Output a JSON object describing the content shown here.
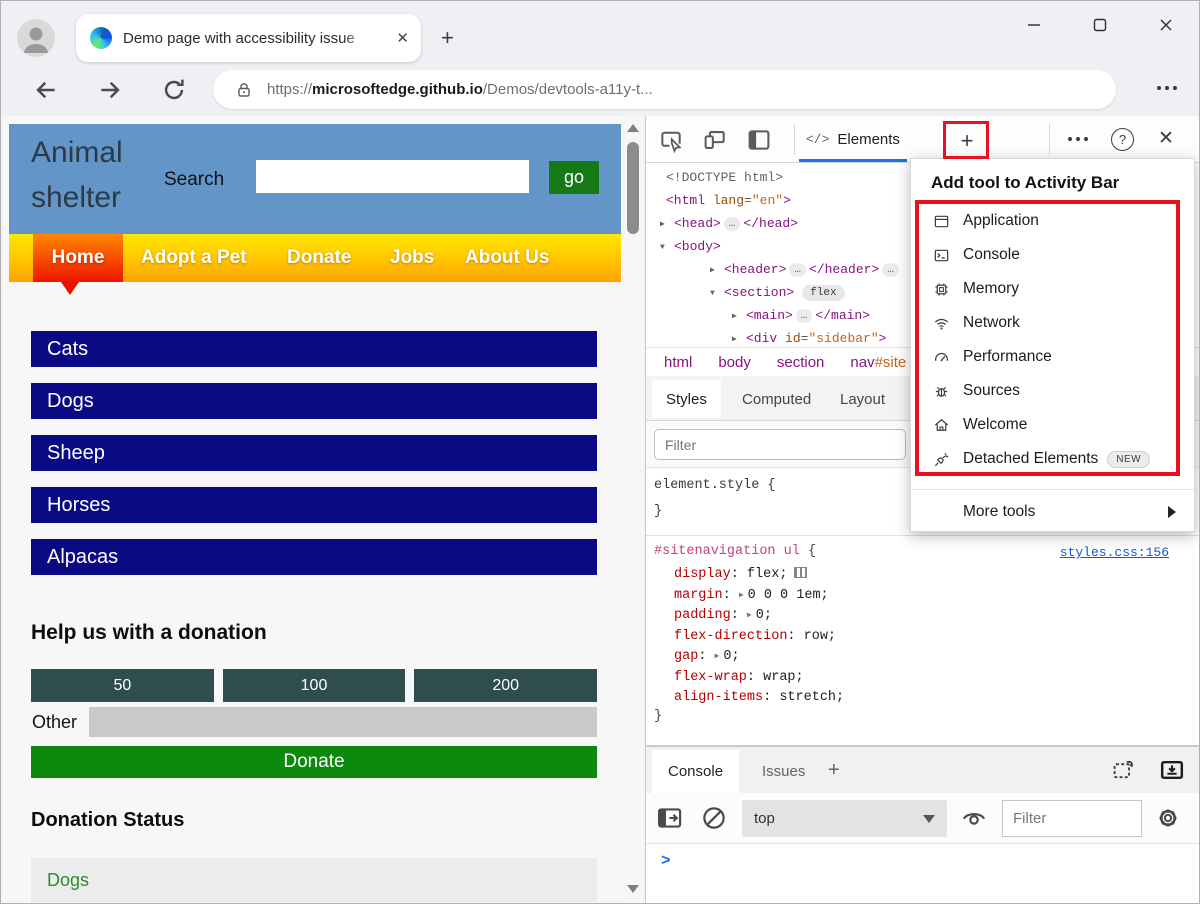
{
  "browser": {
    "tab_title": "Demo page with accessibility issue",
    "tab_close": "✕",
    "url": {
      "scheme": "https://",
      "domain": "microsoftedge.github.io",
      "path": "/Demos/devtools-a11y-t..."
    }
  },
  "page": {
    "site_title": "Animal shelter",
    "search_label": "Search",
    "go_button": "go",
    "nav_items": [
      "Home",
      "Adopt a Pet",
      "Donate",
      "Jobs",
      "About Us"
    ],
    "animals": [
      "Cats",
      "Dogs",
      "Sheep",
      "Horses",
      "Alpacas"
    ],
    "donation_heading": "Help us with a donation",
    "amounts": [
      "50",
      "100",
      "200"
    ],
    "other_label": "Other",
    "donate_button": "Donate",
    "status_heading": "Donation Status",
    "status_rows": [
      "Dogs"
    ]
  },
  "devtools": {
    "elements_tab_label": "Elements",
    "elements_tab_glyph": "</>",
    "dom_lines": [
      {
        "indent": 0,
        "parts": [
          [
            "doctype",
            "<!DOCTYPE html>"
          ]
        ]
      },
      {
        "indent": 0,
        "parts": [
          [
            "tag",
            "<html "
          ],
          [
            "attr",
            "lang"
          ],
          [
            "plain",
            "="
          ],
          [
            "val",
            "\"en\""
          ],
          [
            "tag",
            ">"
          ]
        ]
      },
      {
        "indent": 1,
        "arrow": "r",
        "parts": [
          [
            "tag",
            "<head>"
          ],
          [
            "dots",
            "…"
          ],
          [
            "tag",
            "</head>"
          ]
        ]
      },
      {
        "indent": 1,
        "arrow": "d",
        "parts": [
          [
            "tag",
            "<body>"
          ]
        ]
      },
      {
        "indent": 2,
        "arrow": "r",
        "parts": [
          [
            "tag",
            "<header>"
          ],
          [
            "dots",
            "…"
          ],
          [
            "tag",
            "</header>"
          ],
          [
            "dots",
            "…"
          ]
        ]
      },
      {
        "indent": 2,
        "arrow": "d",
        "parts": [
          [
            "tag",
            "<section>"
          ],
          [
            "flex",
            "flex"
          ]
        ]
      },
      {
        "indent": 3,
        "arrow": "r",
        "parts": [
          [
            "tag",
            "<main>"
          ],
          [
            "dots",
            "…"
          ],
          [
            "tag",
            "</main>"
          ]
        ]
      },
      {
        "indent": 3,
        "arrow": "r",
        "parts": [
          [
            "tag",
            "<div "
          ],
          [
            "attr",
            "id"
          ],
          [
            "plain",
            "="
          ],
          [
            "val",
            "\"sidebar\""
          ],
          [
            "tag",
            ">"
          ]
        ]
      }
    ],
    "breadcrumb": [
      "html",
      "body",
      "section"
    ],
    "breadcrumb_last": {
      "tag": "nav",
      "id": "#site"
    },
    "styles_tabs": [
      "Styles",
      "Computed",
      "Layout"
    ],
    "styles_filter_placeholder": "Filter",
    "element_style_open": "element.style {",
    "element_style_close": "}",
    "rule": {
      "selector": "#sitenavigation ul",
      "brace_open": "{",
      "brace_close": "}",
      "source_link": "styles.css:156",
      "properties": [
        {
          "name": "display",
          "value": "flex",
          "icon": "flex"
        },
        {
          "name": "margin",
          "value": "0 0 0 1em",
          "exp": true
        },
        {
          "name": "padding",
          "value": "0",
          "exp": true
        },
        {
          "name": "flex-direction",
          "value": "row"
        },
        {
          "name": "gap",
          "value": "0",
          "exp": true
        },
        {
          "name": "flex-wrap",
          "value": "wrap"
        },
        {
          "name": "align-items",
          "value": "stretch"
        }
      ]
    },
    "menu": {
      "title": "Add tool to Activity Bar",
      "items": [
        "Application",
        "Console",
        "Memory",
        "Network",
        "Performance",
        "Sources",
        "Welcome",
        "Detached Elements"
      ],
      "new_badge": "NEW",
      "more_tools": "More tools"
    },
    "drawer": {
      "tabs": [
        "Console",
        "Issues"
      ],
      "context_selector": "top",
      "filter_placeholder": "Filter"
    }
  },
  "colors": {
    "annotation_red": "#e81123",
    "accent_blue": "#1a73e8",
    "page_header_blue": "#6495c8",
    "navy_bar": "#0a0a85",
    "go_green": "#157a15",
    "donate_green": "#0d8a0d",
    "amount_slate": "#2f4d4d",
    "nav_yellow": "#ffe800",
    "nav_orange": "#ffa200",
    "home_red": "#ee1500"
  }
}
